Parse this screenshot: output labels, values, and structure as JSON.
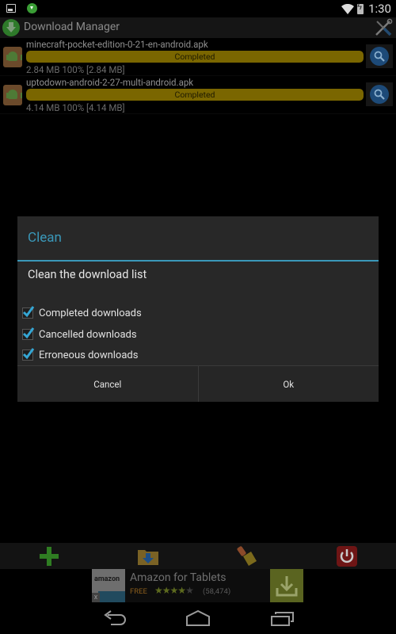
{
  "status_bar": {
    "notification_icons": [
      "image-icon",
      "download-manager-icon"
    ],
    "time": "1:30",
    "wifi": "connected",
    "battery": "charging"
  },
  "app_bar": {
    "title": "Download Manager",
    "settings_icon": "tools-icon"
  },
  "downloads": [
    {
      "name": "minecraft-pocket-edition-0-21-en-android.apk",
      "status": "Completed",
      "progress_percent": 100,
      "stats": "2.84 MB  100% [2.84 MB]"
    },
    {
      "name": "uptodown-android-2-27-multi-android.apk",
      "status": "Completed",
      "progress_percent": 100,
      "stats": "4.14 MB  100% [4.14 MB]"
    }
  ],
  "dialog": {
    "title": "Clean",
    "message": "Clean the download list",
    "options": [
      {
        "label": "Completed downloads",
        "checked": true
      },
      {
        "label": "Cancelled downloads",
        "checked": true
      },
      {
        "label": "Erroneous downloads",
        "checked": true
      }
    ],
    "cancel_label": "Cancel",
    "ok_label": "Ok",
    "accent_color": "#3a98b9"
  },
  "toolbar": {
    "buttons": [
      "add-icon",
      "download-folder-icon",
      "clean-brush-icon",
      "power-exit-icon"
    ]
  },
  "ad": {
    "logo_text": "amazon",
    "title": "Amazon for Tablets",
    "price": "FREE",
    "rating_stars": 4.5,
    "rating_max": 5,
    "rating_count": "(58,474)",
    "close_label": "x"
  },
  "nav_bar": {
    "buttons": [
      "back",
      "home",
      "recents"
    ]
  }
}
